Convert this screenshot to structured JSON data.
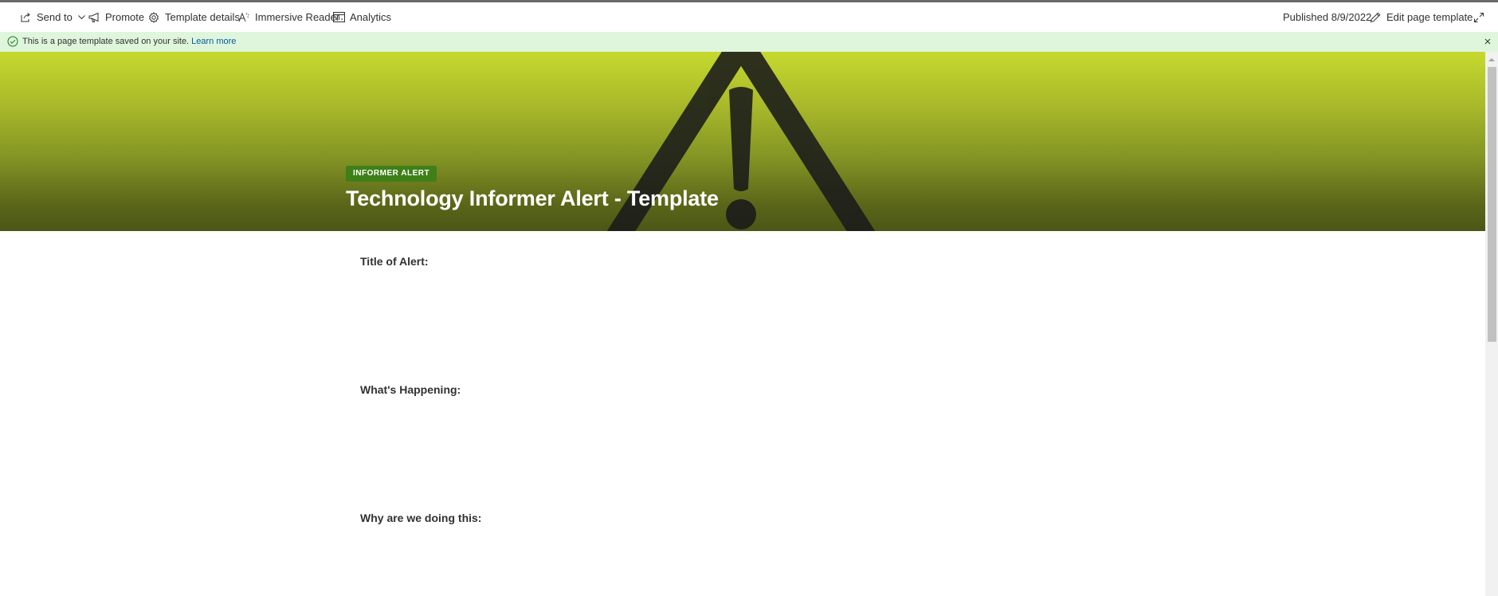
{
  "toolbar": {
    "send_to": "Send to",
    "promote": "Promote",
    "template_details": "Template details",
    "immersive_reader": "Immersive Reader",
    "analytics": "Analytics",
    "published": "Published 8/9/2022",
    "edit_page_template": "Edit page template"
  },
  "banner": {
    "message": "This is a page template saved on your site.",
    "link": "Learn more"
  },
  "hero": {
    "badge": "INFORMER ALERT",
    "title": "Technology Informer Alert - Template"
  },
  "sections": [
    {
      "heading": "Title of Alert:"
    },
    {
      "heading": "What's Happening:"
    },
    {
      "heading": "Why are we doing this:"
    }
  ],
  "colors": {
    "banner_bg": "#dff6dd",
    "badge_bg": "#3f7f18",
    "hero_top": "#c6d92e",
    "hero_bottom": "#4b5616",
    "link": "#005a9e"
  }
}
